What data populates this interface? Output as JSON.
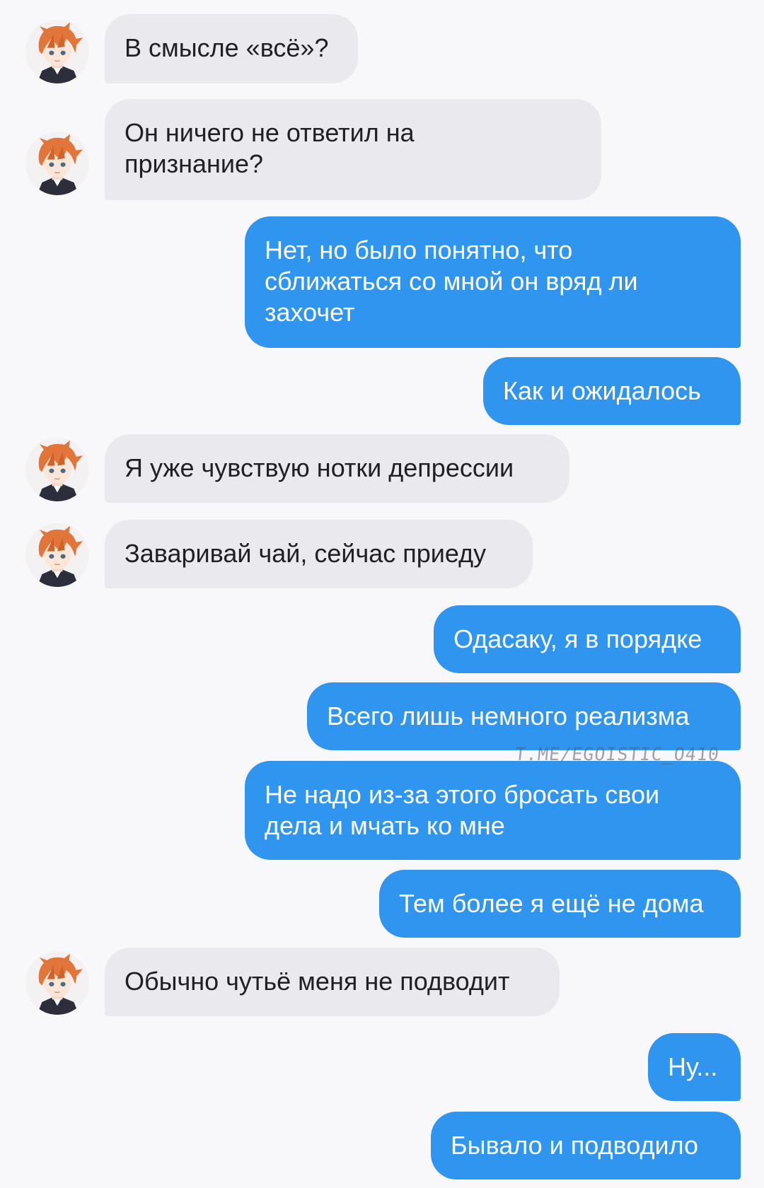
{
  "chat": {
    "messages": [
      {
        "side": "in",
        "text": "В смысле «всё»?"
      },
      {
        "side": "in",
        "text": "Он ничего не ответил на\nпризнание?"
      },
      {
        "side": "out",
        "text": "Нет, но было понятно, что\nсближаться со мной он вряд ли\nзахочет"
      },
      {
        "side": "out",
        "text": "Как и ожидалось"
      },
      {
        "side": "in",
        "text": "Я уже чувствую нотки депрессии"
      },
      {
        "side": "in",
        "text": "Заваривай чай, сейчас приеду"
      },
      {
        "side": "out",
        "text": "Одасаку, я в порядке"
      },
      {
        "side": "out",
        "text": "Всего лишь немного реализма"
      },
      {
        "side": "out",
        "text": "Не надо из-за этого бросать свои\nдела и мчать ко мне"
      },
      {
        "side": "out",
        "text": "Тем более я ещё не дома"
      },
      {
        "side": "in",
        "text": "Обычно чутьё меня не подводит"
      },
      {
        "side": "out",
        "text": "Ну..."
      },
      {
        "side": "out",
        "text": "Бывало и подводило"
      }
    ]
  },
  "contact": {
    "avatar_icon": "avatar-orange-haired-character-icon"
  },
  "watermark": {
    "text": "T.ME/EGOISTIC_O410"
  },
  "colors": {
    "background": "#f8f8fa",
    "incoming_bubble": "#e9e9ee",
    "incoming_text": "#1f1f24",
    "outgoing_bubble": "#2f95ee",
    "outgoing_text": "#ffffff",
    "avatar_hair": "#e2763a"
  }
}
